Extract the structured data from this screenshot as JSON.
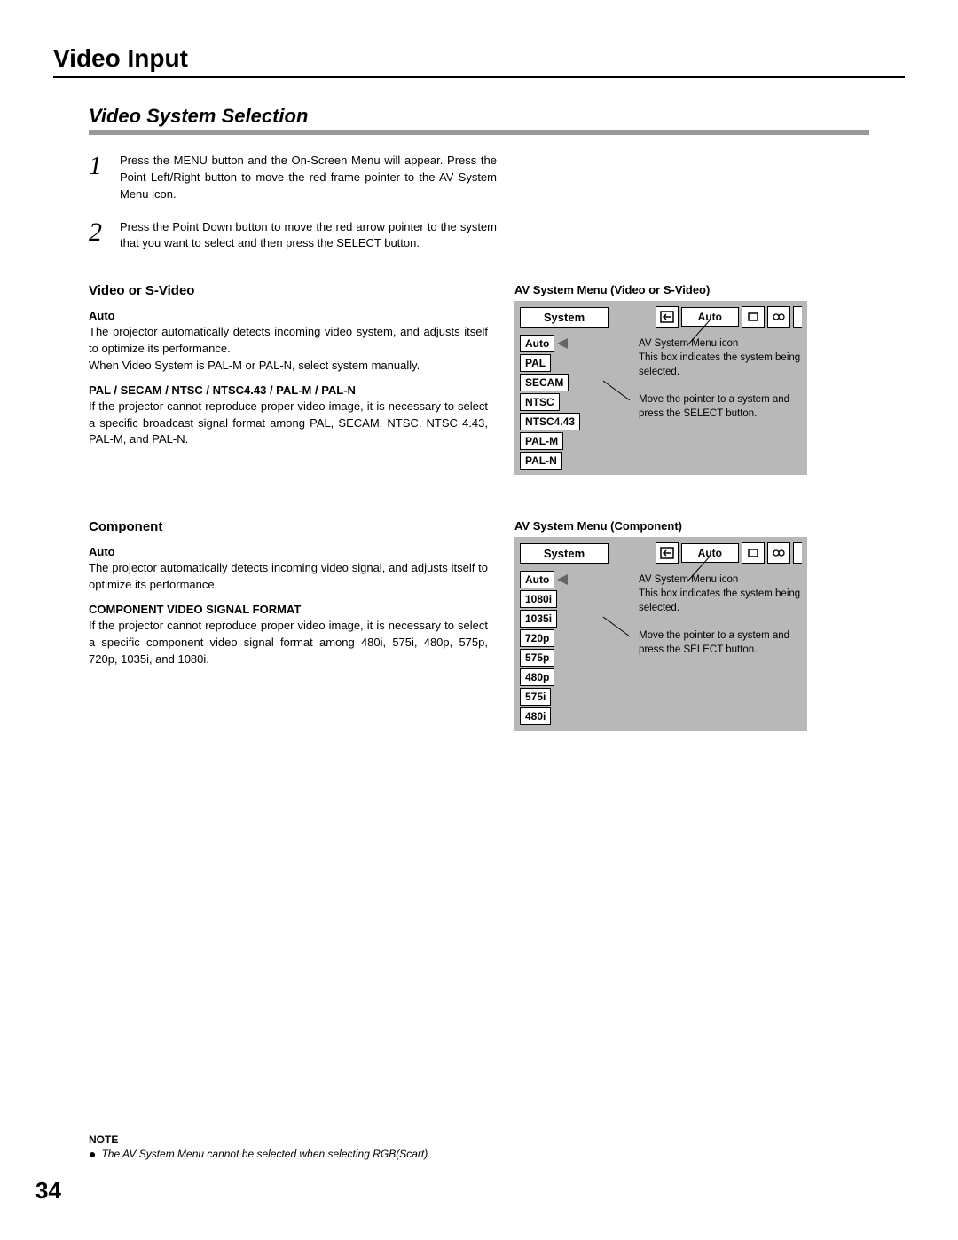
{
  "pageTitle": "Video Input",
  "sectionHeading": "Video System Selection",
  "step1Num": "1",
  "step1Text": "Press the MENU button and the On-Screen Menu will appear. Press the Point Left/Right button to move the red frame pointer to the AV System Menu icon.",
  "step2Num": "2",
  "step2Text": "Press the Point Down button to move the red arrow pointer to the system that you want to select and then press the SELECT button.",
  "video": {
    "heading": "Video or S-Video",
    "autoHeading": "Auto",
    "autoText1": "The projector automatically detects incoming video system, and adjusts itself to optimize its performance.",
    "autoText2": "When Video System is PAL-M or PAL-N, select system manually.",
    "palHeading": "PAL / SECAM / NTSC / NTSC4.43 / PAL-M / PAL-N",
    "palText": "If the projector cannot reproduce proper video image, it is necessary to select a specific broadcast signal format among PAL, SECAM, NTSC, NTSC 4.43, PAL-M, and PAL-N.",
    "menuTitle": "AV System Menu (Video or S-Video)",
    "systemLabel": "System",
    "autoLabel": "Auto",
    "options": [
      "Auto",
      "PAL",
      "SECAM",
      "NTSC",
      "NTSC4.43",
      "PAL-M",
      "PAL-N"
    ],
    "callout1a": "AV System Menu icon",
    "callout1b": "This box indicates the system being selected.",
    "callout2": "Move the pointer to a system and press the SELECT button."
  },
  "component": {
    "heading": "Component",
    "autoHeading": "Auto",
    "autoText": "The projector automatically detects incoming video signal, and adjusts itself to optimize its performance.",
    "formatHeading": "COMPONENT VIDEO SIGNAL FORMAT",
    "formatText": "If the projector cannot reproduce proper video image, it is necessary to select a specific component video signal format among 480i, 575i, 480p, 575p, 720p, 1035i, and 1080i.",
    "menuTitle": "AV System Menu (Component)",
    "systemLabel": "System",
    "autoLabel": "Auto",
    "options": [
      "Auto",
      "1080i",
      "1035i",
      "720p",
      "575p",
      "480p",
      "575i",
      "480i"
    ],
    "callout1a": "AV System Menu icon",
    "callout1b": "This box indicates the system being selected.",
    "callout2": "Move the pointer to a system and press the SELECT button."
  },
  "noteHeading": "NOTE",
  "noteText": "The AV System Menu cannot be selected when selecting RGB(Scart).",
  "pageNumber": "34"
}
